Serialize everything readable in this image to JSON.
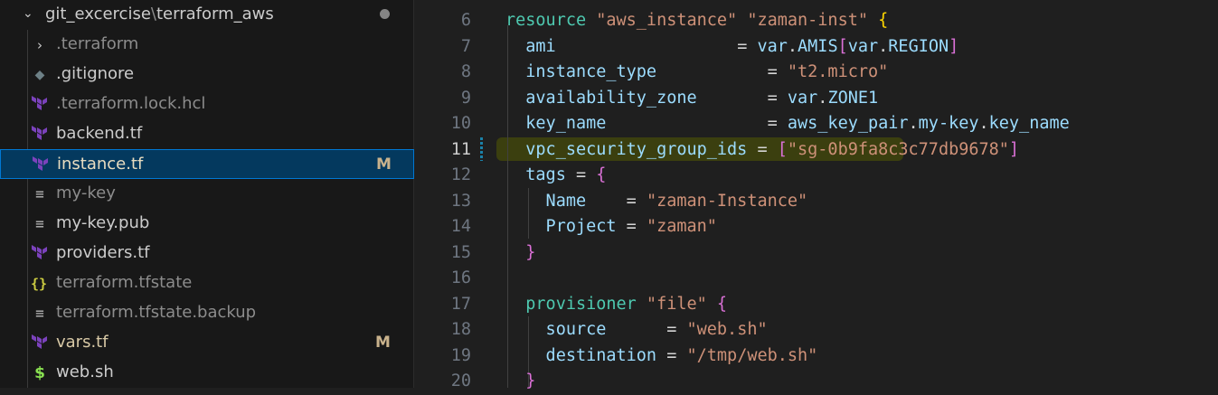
{
  "explorer": {
    "folder_name": "git_excercise",
    "path_separator": "\\",
    "subfolder_name": "terraform_aws",
    "files": [
      {
        "name": ".terraform",
        "type": "folder",
        "dimmed": true,
        "badge": ""
      },
      {
        "name": ".gitignore",
        "type": "git",
        "dimmed": false,
        "badge": ""
      },
      {
        "name": ".terraform.lock.hcl",
        "type": "terraform",
        "dimmed": true,
        "badge": ""
      },
      {
        "name": "backend.tf",
        "type": "terraform",
        "dimmed": false,
        "badge": ""
      },
      {
        "name": "instance.tf",
        "type": "terraform",
        "dimmed": false,
        "badge": "M",
        "selected": true
      },
      {
        "name": "my-key",
        "type": "text",
        "dimmed": true,
        "badge": ""
      },
      {
        "name": "my-key.pub",
        "type": "text",
        "dimmed": false,
        "badge": ""
      },
      {
        "name": "providers.tf",
        "type": "terraform",
        "dimmed": false,
        "badge": ""
      },
      {
        "name": "terraform.tfstate",
        "type": "json",
        "dimmed": true,
        "badge": ""
      },
      {
        "name": "terraform.tfstate.backup",
        "type": "text",
        "dimmed": true,
        "badge": ""
      },
      {
        "name": "vars.tf",
        "type": "terraform",
        "dimmed": false,
        "badge": "M"
      },
      {
        "name": "web.sh",
        "type": "shell",
        "dimmed": false,
        "badge": ""
      }
    ]
  },
  "editor": {
    "active_line": 11,
    "lines": [
      {
        "n": "6",
        "tokens": [
          [
            "kw",
            "resource"
          ],
          [
            "",
            ""
          ],
          [
            "str",
            " \"aws_instance\""
          ],
          [
            "str",
            " \"zaman-inst\""
          ],
          [
            "",
            " "
          ],
          [
            "br1",
            "{"
          ]
        ]
      },
      {
        "n": "7",
        "tokens": [
          [
            "attr",
            "  ami"
          ],
          [
            "",
            " "
          ],
          [
            "",
            "                 = "
          ],
          [
            "attr",
            "var"
          ],
          [
            "",
            "."
          ],
          [
            "attr",
            "AMIS"
          ],
          [
            "br2",
            "["
          ],
          [
            "attr",
            "var"
          ],
          [
            "",
            "."
          ],
          [
            "attr",
            "REGION"
          ],
          [
            "br2",
            "]"
          ]
        ]
      },
      {
        "n": "8",
        "tokens": [
          [
            "attr",
            "  instance_type"
          ],
          [
            "",
            "           = "
          ],
          [
            "str",
            "\"t2.micro\""
          ]
        ]
      },
      {
        "n": "9",
        "tokens": [
          [
            "attr",
            "  availability_zone"
          ],
          [
            "",
            "       = "
          ],
          [
            "attr",
            "var"
          ],
          [
            "",
            "."
          ],
          [
            "attr",
            "ZONE1"
          ]
        ]
      },
      {
        "n": "10",
        "tokens": [
          [
            "attr",
            "  key_name"
          ],
          [
            "",
            "                = "
          ],
          [
            "attr",
            "aws_key_pair"
          ],
          [
            "",
            "."
          ],
          [
            "attr",
            "my-key"
          ],
          [
            "",
            "."
          ],
          [
            "attr",
            "key_name"
          ]
        ]
      },
      {
        "n": "11",
        "tokens": [
          [
            "attr",
            "  vpc_security_group_ids"
          ],
          [
            "",
            " = "
          ],
          [
            "br2",
            "["
          ],
          [
            "str",
            "\"sg-0b9fa8c3c77db9678\""
          ],
          [
            "br2",
            "]"
          ]
        ]
      },
      {
        "n": "12",
        "tokens": [
          [
            "attr",
            "  tags"
          ],
          [
            "",
            " = "
          ],
          [
            "br2",
            "{"
          ]
        ]
      },
      {
        "n": "13",
        "tokens": [
          [
            "attr",
            "    Name"
          ],
          [
            "",
            "    = "
          ],
          [
            "str",
            "\"zaman-Instance\""
          ]
        ]
      },
      {
        "n": "14",
        "tokens": [
          [
            "attr",
            "    Project"
          ],
          [
            "",
            " = "
          ],
          [
            "str",
            "\"zaman\""
          ]
        ]
      },
      {
        "n": "15",
        "tokens": [
          [
            "br2",
            "  }"
          ]
        ]
      },
      {
        "n": "16",
        "tokens": [
          [
            "",
            ""
          ]
        ]
      },
      {
        "n": "17",
        "tokens": [
          [
            "kw",
            "  provisioner"
          ],
          [
            "str",
            " \"file\""
          ],
          [
            "",
            " "
          ],
          [
            "br2",
            "{"
          ]
        ]
      },
      {
        "n": "18",
        "tokens": [
          [
            "attr",
            "    source"
          ],
          [
            "",
            "      = "
          ],
          [
            "str",
            "\"web.sh\""
          ]
        ]
      },
      {
        "n": "19",
        "tokens": [
          [
            "attr",
            "    destination"
          ],
          [
            "",
            " = "
          ],
          [
            "str",
            "\"/tmp/web.sh\""
          ]
        ]
      },
      {
        "n": "20",
        "tokens": [
          [
            "br2",
            "  }"
          ]
        ]
      }
    ]
  },
  "colors": {
    "keyword": "#4ec9b0",
    "string": "#ce9178",
    "attribute": "#9cdcfe",
    "bracket_gold": "#ffd700",
    "bracket_pink": "#da70d6",
    "modified_badge": "#c9b28c",
    "selection_border": "#0078d4",
    "line_highlight": "#3b3f0f"
  }
}
